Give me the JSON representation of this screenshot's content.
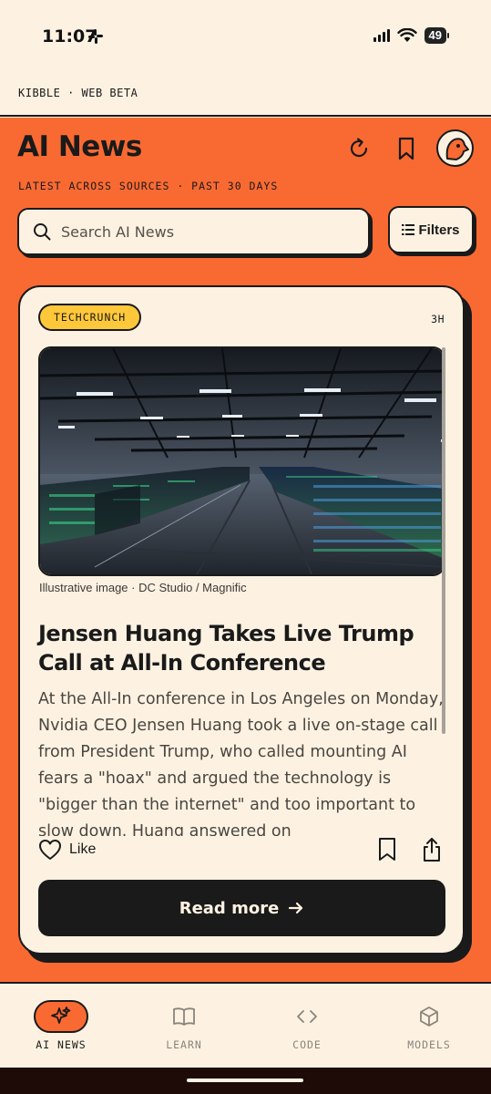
{
  "status_bar": {
    "time": "11:07",
    "battery": "49",
    "notification_icon": "slack-icon"
  },
  "beta_bar": {
    "label": "KIBBLE · WEB BETA"
  },
  "header": {
    "title": "AI News",
    "subtitle": "LATEST ACROSS SOURCES · PAST 30 DAYS",
    "icons": [
      "refresh-icon",
      "bookmark-icon",
      "avatar"
    ]
  },
  "search": {
    "placeholder": "Search AI News",
    "value": ""
  },
  "filters": {
    "label": "Filters"
  },
  "article": {
    "source": "TECHCRUNCH",
    "age": "3H",
    "image_caption": "Illustrative image · DC Studio / Magnific",
    "headline": "Jensen Huang Takes Live Trump Call at All-In Conference",
    "summary": "At the All-In conference in Los Angeles on Monday, Nvidia CEO Jensen Huang took a live on-stage call from President Trump, who called mounting AI fears a \"hoax\" and argued the technology is \"bigger than the internet\" and too important to slow down. Huang answered on",
    "like_label": "Like",
    "read_more_label": "Read more",
    "colors": {
      "badge": "#ffc83a"
    }
  },
  "bottom_nav": {
    "items": [
      {
        "label": "AI NEWS",
        "icon": "sparkles-icon",
        "active": true
      },
      {
        "label": "LEARN",
        "icon": "book-icon",
        "active": false
      },
      {
        "label": "CODE",
        "icon": "code-icon",
        "active": false
      },
      {
        "label": "MODELS",
        "icon": "cube-icon",
        "active": false
      }
    ]
  },
  "theme": {
    "accent": "#f96a33",
    "background": "#fdf2e2",
    "ink": "#1a1a1a"
  }
}
